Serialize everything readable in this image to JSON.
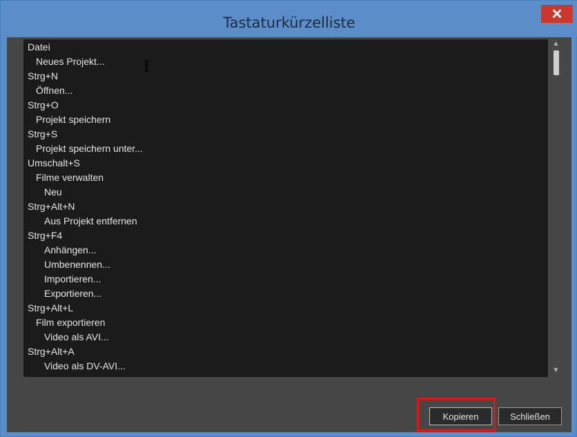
{
  "window": {
    "title": "Tastaturkürzelliste"
  },
  "titlebar": {
    "close_glyph": "✕"
  },
  "list": {
    "items": [
      "Datei",
      "Neues Projekt...",
      "Strg+N",
      "Öffnen...",
      "Strg+O",
      "Projekt speichern",
      "Strg+S",
      "Projekt speichern unter...",
      "Umschalt+S",
      "Filme verwalten",
      "Neu",
      "Strg+Alt+N",
      "Aus Projekt entfernen",
      "Strg+F4",
      "Anhängen...",
      "Umbenennen...",
      "Importieren...",
      "Exportieren...",
      "Strg+Alt+L",
      "Film exportieren",
      "Video als AVI...",
      "Strg+Alt+A",
      "Video als DV-AVI..."
    ]
  },
  "scrollbar": {
    "up_glyph": "▲",
    "down_glyph": "▼"
  },
  "buttons": {
    "copy": "Kopieren",
    "close": "Schließen"
  },
  "cursor": {
    "glyph": "I"
  }
}
